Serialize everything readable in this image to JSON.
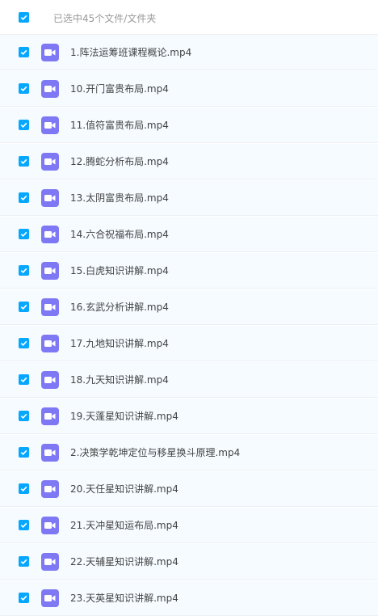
{
  "header": {
    "selection_text": "已选中45个文件/文件夹"
  },
  "colors": {
    "checkbox": "#06a7ff",
    "video_icon": "#7f78f5"
  },
  "files": [
    {
      "name": "1.阵法运筹班课程概论.mp4",
      "checked": true,
      "icon": "video-file-icon"
    },
    {
      "name": "10.开门富贵布局.mp4",
      "checked": true,
      "icon": "video-file-icon"
    },
    {
      "name": "11.值符富贵布局.mp4",
      "checked": true,
      "icon": "video-file-icon"
    },
    {
      "name": "12.腾蛇分析布局.mp4",
      "checked": true,
      "icon": "video-file-icon"
    },
    {
      "name": "13.太阴富贵布局.mp4",
      "checked": true,
      "icon": "video-file-icon"
    },
    {
      "name": "14.六合祝福布局.mp4",
      "checked": true,
      "icon": "video-file-icon"
    },
    {
      "name": "15.白虎知识讲解.mp4",
      "checked": true,
      "icon": "video-file-icon"
    },
    {
      "name": "16.玄武分析讲解.mp4",
      "checked": true,
      "icon": "video-file-icon"
    },
    {
      "name": "17.九地知识讲解.mp4",
      "checked": true,
      "icon": "video-file-icon"
    },
    {
      "name": "18.九天知识讲解.mp4",
      "checked": true,
      "icon": "video-file-icon"
    },
    {
      "name": "19.天蓬星知识讲解.mp4",
      "checked": true,
      "icon": "video-file-icon"
    },
    {
      "name": "2.决策学乾坤定位与移星换斗原理.mp4",
      "checked": true,
      "icon": "video-file-icon"
    },
    {
      "name": "20.天任星知识讲解.mp4",
      "checked": true,
      "icon": "video-file-icon"
    },
    {
      "name": "21.天冲星知运布局.mp4",
      "checked": true,
      "icon": "video-file-icon"
    },
    {
      "name": "22.天辅星知识讲解.mp4",
      "checked": true,
      "icon": "video-file-icon"
    },
    {
      "name": "23.天英星知识讲解.mp4",
      "checked": true,
      "icon": "video-file-icon"
    }
  ]
}
